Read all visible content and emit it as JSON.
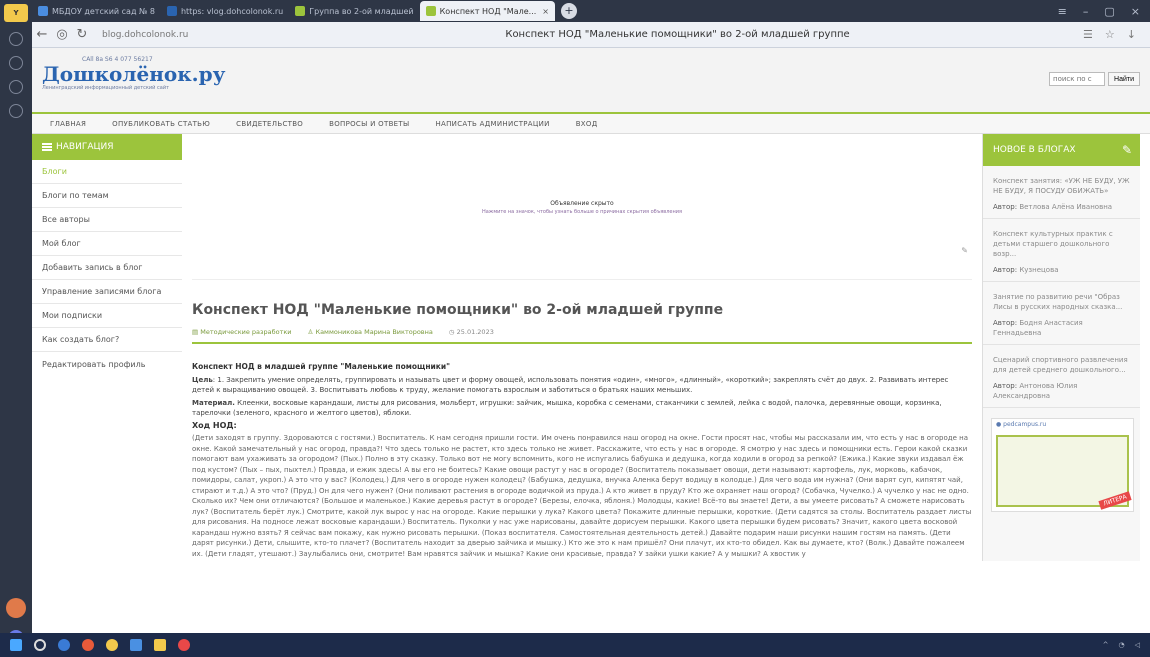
{
  "browser": {
    "tabs": [
      {
        "label": "МБДОУ детский сад № 8",
        "color": "#4a8de0"
      },
      {
        "label": "https: vlog.dohcolonok.ru",
        "color": "#2a64b0"
      },
      {
        "label": "Группа во 2-ой младшей",
        "color": "#9cc43c"
      },
      {
        "label": "Конспект НОД \"Мале...",
        "color": "#9cc43c"
      }
    ],
    "url": "blog.dohcolonok.ru",
    "page_title": "Конспект НОД \"Маленькие помощники\" во 2-ой младшей группе"
  },
  "site": {
    "logo_phone": "CAll 8a S6 4 077 56217",
    "logo_text": "Дошколёнок.ру",
    "logo_sub": "Ленинградский информационный детский сайт",
    "search_placeholder": "поиск по с",
    "search_button": "Найти"
  },
  "menu": [
    "ГЛАВНАЯ",
    "ОПУБЛИКОВАТЬ СТАТЬЮ",
    "СВИДЕТЕЛЬСТВО",
    "ВОПРОСЫ И ОТВЕТЫ",
    "НАПИСАТЬ АДМИНИСТРАЦИИ",
    "ВХОД"
  ],
  "nav": {
    "title": "НАВИГАЦИЯ",
    "items": [
      "Блоги",
      "Блоги по темам",
      "Все авторы",
      "Мой блог",
      "Добавить запись в блог",
      "Управление записями блога",
      "Мои подписки",
      "Как создать блог?",
      "Редактировать профиль"
    ]
  },
  "ad": {
    "label": "Объявление скрыто",
    "sub": "Нажмите на значок, чтобы узнать больше о причинах скрытия объявления"
  },
  "article": {
    "title": "Конспект НОД \"Маленькие помощники\" во 2-ой младшей группе",
    "category": "Методические разработки",
    "author": "Каммоникова Марина Викторовна",
    "date": "25.01.2023",
    "heading": "Конспект НОД в младшей группе \"Маленькие помощники\"",
    "goal_label": "Цель",
    "goal_text": ": 1. Закрепить умение определять, группировать и называть цвет и форму овощей, использовать понятия «один», «много», «длинный», «короткий»; закреплять счёт до двух. 2. Развивать интерес детей к выращиванию овощей. 3. Воспитывать любовь к труду, желание помогать взрослым и заботиться о братьях наших меньших.",
    "material_label": "Материал.",
    "material_text": " Клеенки, восковые карандаши, листы для рисования, мольберт, игрушки: зайчик, мышка, коробка с семенами, стаканчики с землей, лейка с водой, палочка, деревянные овощи, корзинка, тарелочки (зеленого, красного и желтого цветов), яблоки.",
    "hod_label": "Ход НОД:",
    "hod_text": "(Дети заходят в группу. Здороваются с гостями.) Воспитатель. К нам сегодня пришли гости. Им очень понравился наш огород на окне. Гости просят нас, чтобы мы рассказали им, что есть у нас в огороде на окне. Какой замечательный у нас огород, правда?! Что здесь только не растет, кто здесь только не живет. Расскажите, что есть у нас в огороде. Я смотрю у нас здесь и помощники есть. Герои какой сказки помогают вам ухаживать за огородом? (Пых.) Полно в эту сказку. Только вот не могу вспомнить, кого не испугались бабушка и дедушка, когда ходили в огород за репкой? (Ежика.) Какие звуки издавал ёж под кустом? (Пых – пых, пыхтел.) Правда, и ежик здесь! А вы его не боитесь? Какие овощи растут у нас в огороде? (Воспитатель показывает овощи, дети называют: картофель, лук, морковь, кабачок, помидоры, салат, укроп.) А это что у вас? (Колодец.) Для чего в огороде нужен колодец? (Бабушка, дедушка, внучка Аленка берут водицу в колодце.) Для чего вода им нужна? (Они варят суп, кипятят чай, стирают и т.д.) А это что? (Пруд.) Он для чего нужен? (Они поливают растения в огороде водичкой из пруда.) А кто живет в пруду? Кто же охраняет наш огород? (Собачка, Чучелко.) А чучелко у нас не одно. Сколько их? Чем они отличаются? (Большое и маленькое.) Какие деревья растут в огороде? (Березы, елочка, яблоня.) Молодцы, какие! Всё-то вы знаете! Дети, а вы умеете рисовать? А сможете нарисовать лук? (Воспитатель берёт лук.) Смотрите, какой лук вырос у нас на огороде. Какие перышки у лука? Какого цвета? Покажите длинные перышки, короткие. (Дети садятся за столы. Воспитатель раздает листы для рисования. На подносе лежат восковые карандаши.) Воспитатель. Пуколки у нас уже нарисованы, давайте дорисуем перышки. Какого цвета перышки будем рисовать? Значит, какого цвета восковой карандаш нужно взять? Я сейчас вам покажу, как нужно рисовать перышки. (Показ воспитателя. Самостоятельная деятельность детей.) Давайте подарим наши рисунки нашим гостям на память. (Дети дарят рисунки.) Дети, слышите, кто-то плачет? (Воспитатель находит за дверью зайчика и мышку.) Кто же это к нам пришёл? Они плачут, их кто-то обидел. Как вы думаете, кто? (Волк.) Давайте пожалеем их. (Дети гладят, утешают.) Заулыбались они, смотрите! Вам нравятся зайчик и мышка? Какие они красивые, правда? У зайки ушки какие? А у мышки? А хвостик у"
  },
  "blog": {
    "title": "НОВОЕ В БЛОГАХ",
    "author_label": "Автор:",
    "items": [
      {
        "title": "Конспект занятия: «УЖ НЕ БУДУ, УЖ НЕ БУДУ, Я ПОСУДУ ОБИЖАТЬ»",
        "author": "Ветлова Алёна Ивановна"
      },
      {
        "title": "Конспект культурных практик с детьми старшего дошкольного возр...",
        "author": "Кузнецова"
      },
      {
        "title": "Занятие по развитию речи \"Образ Лисы в русских народных сказка...",
        "author": "Бодня Анастасия Геннадьевна"
      },
      {
        "title": "Сценарий спортивного развлечения для детей среднего дошкольного...",
        "author": "Антонова Юлия Александровна"
      }
    ],
    "promo_label": "pedcampus.ru",
    "promo_ribbon": "ЛИТЕРА"
  }
}
